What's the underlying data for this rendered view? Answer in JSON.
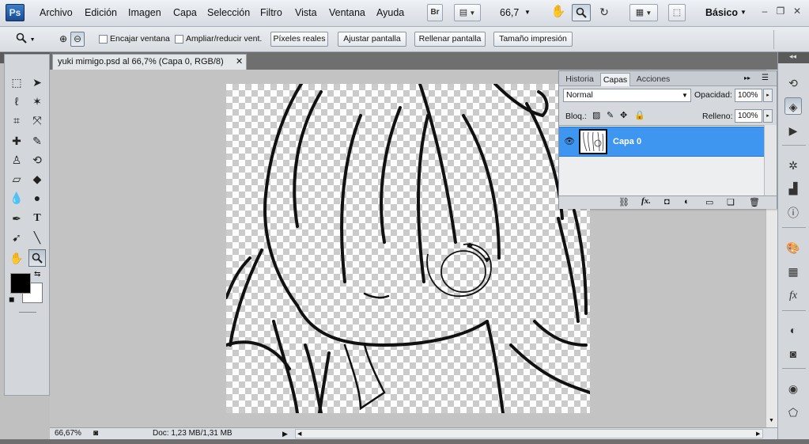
{
  "app": {
    "logo": "Ps"
  },
  "menu": [
    "Archivo",
    "Edición",
    "Imagen",
    "Capa",
    "Selección",
    "Filtro",
    "Vista",
    "Ventana",
    "Ayuda"
  ],
  "appbar": {
    "bridge": "Br",
    "zoom": "66,7",
    "workspace": "Básico"
  },
  "options": {
    "fit_window": "Encajar ventana",
    "resize_windows": "Ampliar/reducir vent.",
    "actual_pixels": "Píxeles reales",
    "fit_screen": "Ajustar pantalla",
    "fill_screen": "Rellenar pantalla",
    "print_size": "Tamaño impresión"
  },
  "document": {
    "tab_title": "yuki mimigo.psd al 66,7% (Capa 0, RGB/8)"
  },
  "status": {
    "zoom": "66,67%",
    "doc_size": "Doc: 1,23 MB/1,31 MB"
  },
  "layers_panel": {
    "tabs": [
      "Historia",
      "Capas",
      "Acciones"
    ],
    "active_tab": "Capas",
    "blend_mode": "Normal",
    "opacity_label": "Opacidad:",
    "opacity": "100%",
    "lock_label": "Bloq.:",
    "fill_label": "Relleno:",
    "fill": "100%",
    "layers": [
      {
        "name": "Capa 0",
        "visible": true,
        "selected": true
      }
    ]
  },
  "colors": {
    "foreground": "#000000",
    "background": "#ffffff",
    "selection": "#3f96f0"
  }
}
